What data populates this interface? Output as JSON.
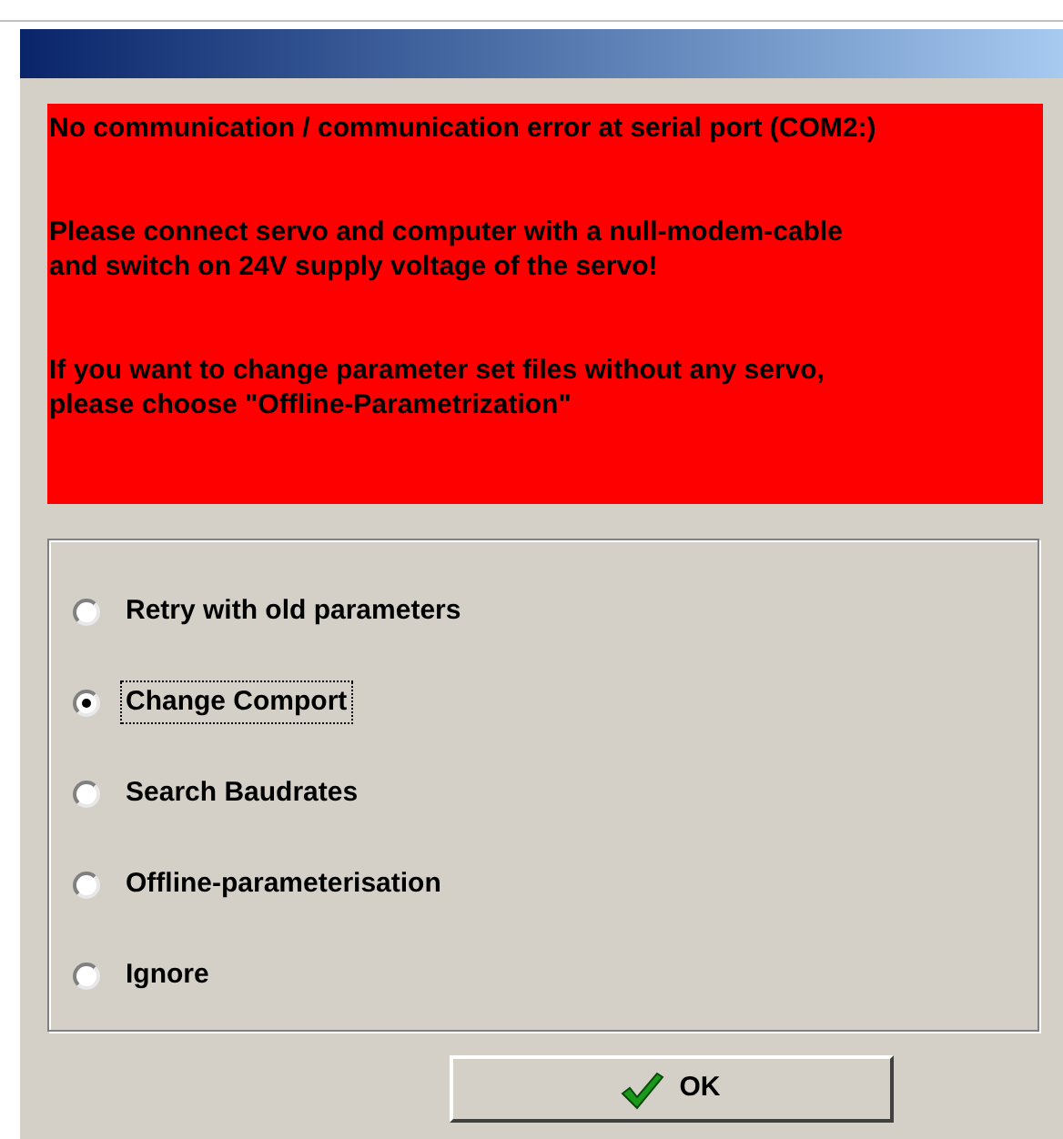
{
  "message": {
    "lines": [
      "No communication / communication error at serial port (COM2:)",
      "Please connect servo and computer with a null-modem-cable\nand switch on 24V supply voltage of the servo!",
      "If you want to change parameter set files without any servo,\nplease choose \"Offline-Parametrization\""
    ]
  },
  "options": [
    {
      "label": "Retry with old parameters",
      "selected": false
    },
    {
      "label": "Change Comport",
      "selected": true
    },
    {
      "label": "Search Baudrates",
      "selected": false
    },
    {
      "label": "Offline-parameterisation",
      "selected": false
    },
    {
      "label": "Ignore",
      "selected": false
    }
  ],
  "ok_button": {
    "label": "OK"
  }
}
